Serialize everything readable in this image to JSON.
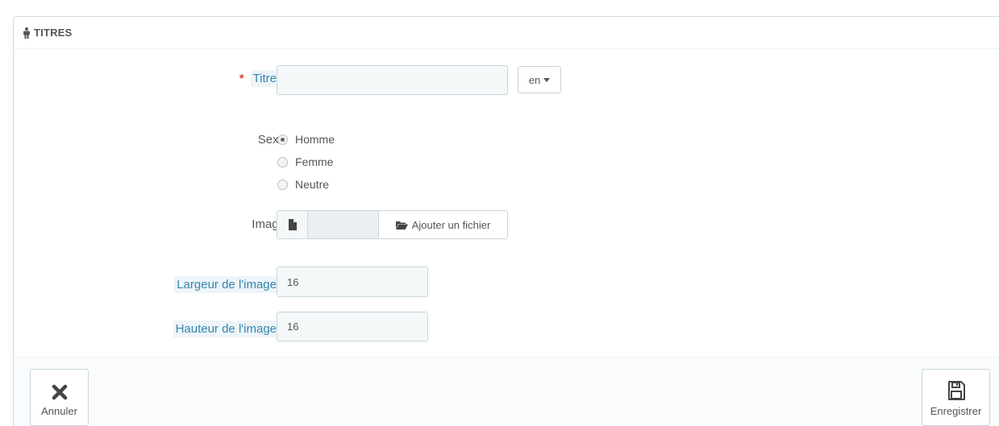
{
  "panel": {
    "title": "TITRES",
    "title_icon": "male-icon"
  },
  "form": {
    "titre": {
      "label": "Titre",
      "required_mark": "*",
      "value": "",
      "language": "en"
    },
    "sexe": {
      "label": "Sexe",
      "options": [
        {
          "label": "Homme",
          "checked": true
        },
        {
          "label": "Femme",
          "checked": false
        },
        {
          "label": "Neutre",
          "checked": false
        }
      ]
    },
    "image": {
      "label": "Image",
      "file_name": "",
      "add_file_label": "Ajouter un fichier"
    },
    "largeur": {
      "label": "Largeur de l'image",
      "value": "16"
    },
    "hauteur": {
      "label": "Hauteur de l'image",
      "value": "16"
    }
  },
  "footer": {
    "cancel_label": "Annuler",
    "save_label": "Enregistrer"
  },
  "colors": {
    "hint_label": "#3586ae",
    "required": "#e0413c"
  }
}
